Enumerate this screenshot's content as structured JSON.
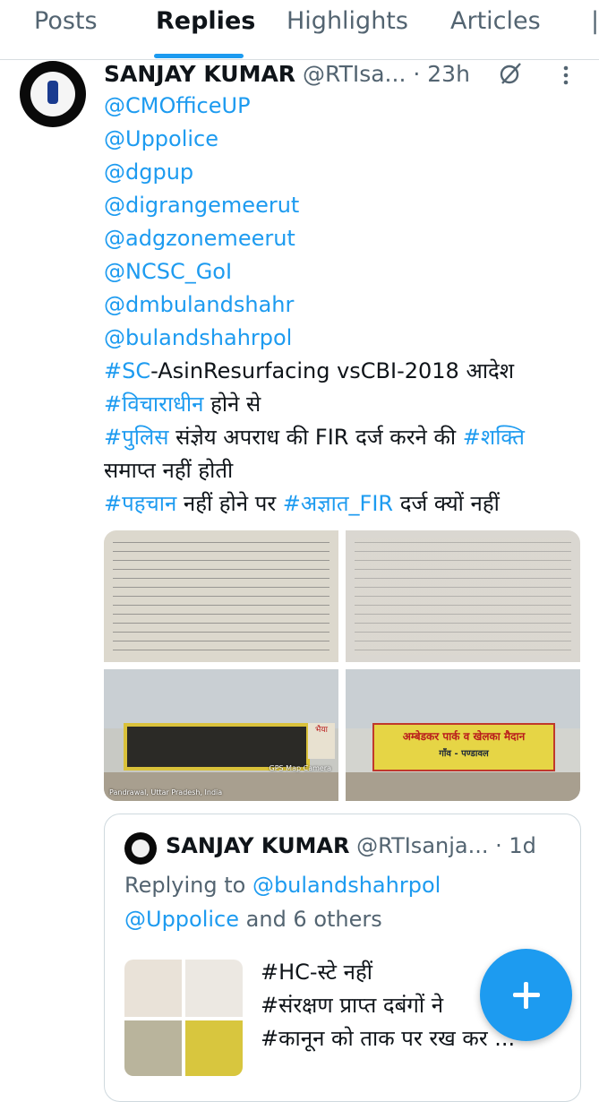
{
  "tabs": [
    "Posts",
    "Replies",
    "Highlights",
    "Articles"
  ],
  "active_tab": "Replies",
  "tweet": {
    "author_name": "SANJAY KUMAR",
    "author_handle": "@RTIsa...",
    "time": "· 23h",
    "mentions": [
      "@CMOfficeUP",
      "@Uppolice",
      "@dgpup",
      "@digrangemeerut",
      "@adgzonemeerut",
      "@NCSC_GoI",
      "@dmbulandshahr",
      "@bulandshahrpol"
    ],
    "line1_tag": "#SC",
    "line1_rest": "-AsinResurfacing vsCBI-2018 आदेश",
    "line2_tag": "#विचाराधीन",
    "line2_rest": " होने से",
    "line3_tag": "#पुलिस",
    "line3_mid": " संज्ञेय अपराध की FIR दर्ज करने की ",
    "line3_tag2": "#शक्ति",
    "line4": "समाप्त नहीं होती",
    "line5_tag": "#पहचान",
    "line5_mid": " नहीं होने पर ",
    "line5_tag2": "#अज्ञात_FIR",
    "line5_rest": " दर्ज क्यों नहीं"
  },
  "media": {
    "img3_sign": "भैया",
    "img3_caption": "Pandrawal, Uttar Pradesh, India",
    "img3_gps": "GPS Map Camera",
    "img4_sign": "अम्बेडकर पार्क व खेलका मैदान",
    "img4_sub": "गाँव - पण्डावल"
  },
  "quote": {
    "author_name": "SANJAY KUMAR",
    "author_handle": "@RTIsanja...",
    "time": "· 1d",
    "replying_prefix": "Replying to ",
    "replying_handle": "@bulandshahrpol",
    "replying_line2_handle": "@Uppolice",
    "replying_line2_rest": " and 6 others",
    "text_lines": [
      "#HC-स्टे नहीं",
      "#संरक्षण प्राप्त दबंगों ने",
      "#कानून को ताक पर रख कर ..."
    ]
  },
  "colors": {
    "accent": "#1d9bf0",
    "secondary_text": "#536471",
    "primary_text": "#0f1419"
  },
  "icons": [
    "grok-icon",
    "more-icon",
    "compose-plus-icon"
  ]
}
